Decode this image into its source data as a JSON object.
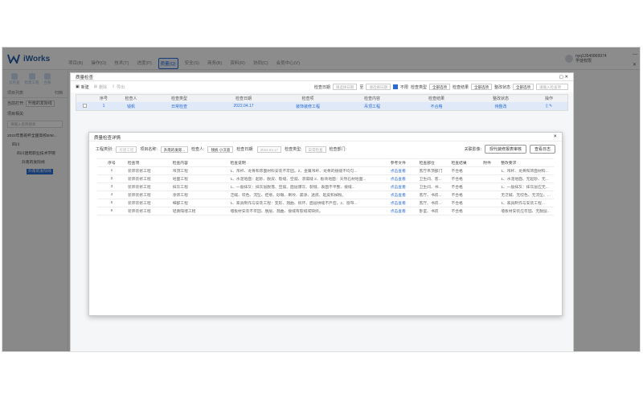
{
  "app": {
    "brand": "iWorks",
    "nav": [
      {
        "label": "项目(B)",
        "active": false
      },
      {
        "label": "操作(O)",
        "active": false
      },
      {
        "label": "技术(T)",
        "active": false
      },
      {
        "label": "进度(P)",
        "active": false
      },
      {
        "label": "质量(Q)",
        "active": true
      },
      {
        "label": "安全(S)",
        "active": false
      },
      {
        "label": "商务(B)",
        "active": false
      },
      {
        "label": "资料(R)",
        "active": false
      },
      {
        "label": "协同(C)",
        "active": false
      },
      {
        "label": "会员中心(V)",
        "active": false
      }
    ],
    "user": {
      "account": "nyq13540869974",
      "role": "学徒权限"
    },
    "win_min": "—",
    "win_close": "✕"
  },
  "sidebar": {
    "tools": [
      "云检查",
      "新建工程",
      "台账"
    ],
    "tab_left": "项目列表",
    "tab_right": "归档",
    "current_open_label": "当前打开:",
    "current_open_value": "升南的发际线",
    "project_related": "项目相关:",
    "search_placeholder": "请输入名称搜索",
    "tree": [
      "2022年鲁班杯全国高校BIM...",
      "四川",
      "四川建筑职业技术学院",
      "升南的发际线",
      "升南的发际线"
    ]
  },
  "dialog1": {
    "title": "质量检查",
    "toolbar": {
      "new": "新建",
      "delete": "删除",
      "export": "导出"
    },
    "filters": {
      "check_date": "检查日期",
      "start_placeholder": "请选择日期",
      "end_placeholder": "请选择日期",
      "overdue": "不限",
      "check_type": "检查类型",
      "type_value": "全部选项",
      "check_result": "检查结果",
      "result_value": "全部选项",
      "rect_status": "整改状态",
      "status_value": "全部选项",
      "search_placeholder": "请输入检查项"
    },
    "columns": [
      "",
      "序号",
      "检查人",
      "检查类型",
      "检查日期",
      "检查项",
      "检查内容",
      "检查结果",
      "整改状态",
      "操作"
    ],
    "rows": [
      [
        "",
        "1",
        "钱帆",
        "日常检查",
        "2022.04.17",
        "装饰装修工程",
        "吊顶工程",
        "不合格",
        "待整改",
        ""
      ]
    ]
  },
  "dialog2": {
    "title": "质量检查详情",
    "close": "✕",
    "form": {
      "project_type_label": "工程类别:",
      "project_type_value": "房建工程",
      "project_name_label": "项目名称:",
      "project_name_value": "升南的发际...",
      "inspector_label": "检查人:",
      "inspector_value": "钱帆 小汉道",
      "date_label": "检查日期:",
      "date_value": "2022.04.17",
      "type_label": "检查类型:",
      "type_value": "日常检查",
      "dept_label": "检查部门:",
      "related_label": "关联影像:",
      "related_btn": "现代装修报表审核",
      "view_log_btn": "查看日志"
    },
    "columns": [
      "序号",
      "检查项",
      "检查内容",
      "检查说明",
      "参考文件",
      "检查部位",
      "检查结果",
      "附件",
      "整改要求"
    ],
    "rows": [
      [
        "1",
        "装饰装修工程",
        "吊顶工程",
        "1、吊杆、龙骨和饰面材料安装不牢固。2、金属吊杆、龙骨的接缝不均匀...",
        "点击查看",
        "客厅吊顶部门",
        "不合格",
        "",
        "1、吊杆、龙骨和饰面材料..."
      ],
      [
        "2",
        "装饰装修工程",
        "地面工程",
        "1、水泥地面：起砂、脱皮、裂缝、空鼓、渗漏缝 2、板块地面：天然石材地面...",
        "点击查看",
        "卫生间、客...",
        "不合格",
        "",
        "1、水泥地面、无起砂、无..."
      ],
      [
        "3",
        "装饰装修工程",
        "抹灰工程",
        "1、一般抹灰：抹灰层脱落、空鼓、面层爆灰、裂缝、表面不平整、接缝...",
        "点击查看",
        "卫生间、书...",
        "不合格",
        "",
        "1、一般抹灰：抹灰层应无..."
      ],
      [
        "4",
        "装饰装修工程",
        "涂饰工程",
        "泛碱、咬色、流坠、疙瘩、砂眼、刷纹、漏涂、透底、起皮和掉粉。",
        "点击查看",
        "客厅、书房...",
        "不合格",
        "",
        "无泛碱、无咬色、无流坠、..."
      ],
      [
        "5",
        "装饰装修工程",
        "细部工程",
        "1、家具制作与安装工程：变形、翘曲、损坏、面层拼缝不严密。2、窗帘...",
        "点击查看",
        "客厅、书房...",
        "不合格",
        "",
        "1、家具制作与安装工程..."
      ],
      [
        "6",
        "装饰装修工程",
        "轻质隔墙工程",
        "墙板材安装不牢固、脱层、翘曲、接缝有裂缝或缺损。",
        "点击查看",
        "卧室、书房",
        "不合格",
        "",
        "墙板材安装应牢固、无脱层..."
      ]
    ]
  }
}
